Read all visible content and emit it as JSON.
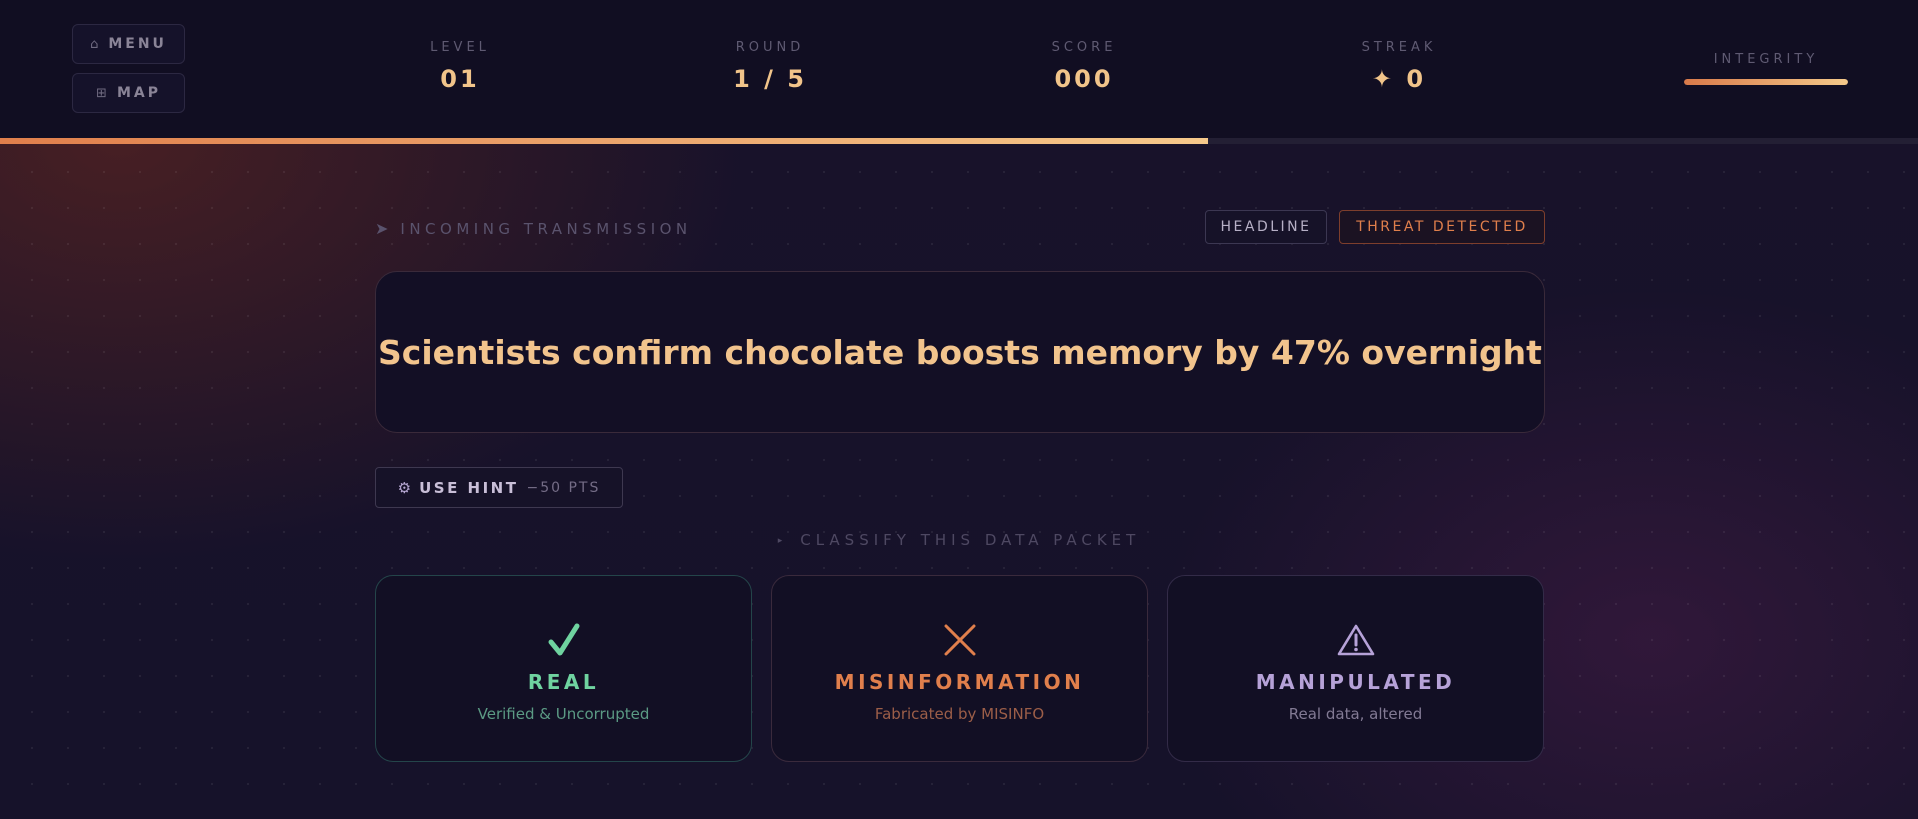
{
  "nav": {
    "menu_icon": "⌂",
    "menu_label": "MENU",
    "map_icon": "⊞",
    "map_label": "MAP"
  },
  "stats": {
    "level_label": "LEVEL",
    "level_value": "01",
    "round_label": "ROUND",
    "round_value": "1 / 5",
    "score_label": "SCORE",
    "score_value": "000",
    "streak_label": "STREAK",
    "streak_value": "✦ 0"
  },
  "integrity": {
    "label": "INTEGRITY",
    "level": 1.0
  },
  "round_progress": 0.63,
  "transmission": {
    "icon": "➤",
    "label": "INCOMING TRANSMISSION"
  },
  "tags": {
    "type": "HEADLINE",
    "threat": "THREAT DETECTED"
  },
  "headline": "Scientists confirm chocolate boosts memory by 47% overnight",
  "hint": {
    "icon": "⚙",
    "label": "USE HINT",
    "cost": "−50 PTS"
  },
  "classify": {
    "icon": "▸",
    "label": "CLASSIFY THIS DATA PACKET"
  },
  "options": {
    "real": {
      "icon": "check-icon",
      "title": "REAL",
      "subtitle": "Verified & Uncorrupted"
    },
    "misinformation": {
      "icon": "x-icon",
      "title": "MISINFORMATION",
      "subtitle": "Fabricated by MISINFO"
    },
    "manipulated": {
      "icon": "warning-icon",
      "title": "MANIPULATED",
      "subtitle": "Real data, altered"
    }
  },
  "colors": {
    "accent_orange": "#e07f4c",
    "accent_gold": "#f2c48d",
    "real_green": "#6fd3a0",
    "manipulated_purple": "#b6a2d8"
  }
}
